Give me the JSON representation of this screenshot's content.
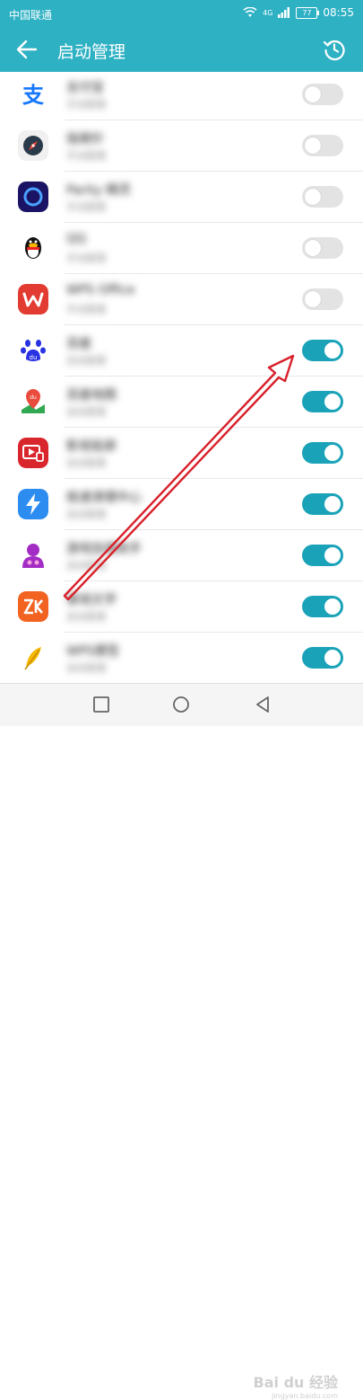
{
  "status_bar": {
    "carrier": "中国联通",
    "signal_text": "4G",
    "battery": "77",
    "time": "08:55"
  },
  "app_bar": {
    "title": "启动管理"
  },
  "apps": [
    {
      "name": "支付宝",
      "sub": "手动管理",
      "icon": "alipay-icon",
      "enabled": false
    },
    {
      "name": "指南针",
      "sub": "手动管理",
      "icon": "compass-icon",
      "enabled": false
    },
    {
      "name": "Parity 精灵",
      "sub": "手动管理",
      "icon": "ring-app-icon",
      "enabled": false
    },
    {
      "name": "QQ",
      "sub": "手动管理",
      "icon": "qq-penguin-icon",
      "enabled": false
    },
    {
      "name": "WPS Office",
      "sub": "手动管理",
      "icon": "wps-icon",
      "enabled": false
    },
    {
      "name": "百度",
      "sub": "自动管理",
      "icon": "baidu-paw-icon",
      "enabled": true
    },
    {
      "name": "百度地图",
      "sub": "自动管理",
      "icon": "baidu-map-icon",
      "enabled": true
    },
    {
      "name": "影视投屏",
      "sub": "自动管理",
      "icon": "video-cast-icon",
      "enabled": true
    },
    {
      "name": "极速清理中心",
      "sub": "自动管理",
      "icon": "lightning-icon",
      "enabled": true
    },
    {
      "name": "游戏加速助手",
      "sub": "自动管理",
      "icon": "avatar-app-icon",
      "enabled": true
    },
    {
      "name": "掌阅文学",
      "sub": "自动管理",
      "icon": "zk-app-icon",
      "enabled": true
    },
    {
      "name": "WPS便签",
      "sub": "自动管理",
      "icon": "feather-icon",
      "enabled": true
    }
  ],
  "watermark": {
    "text": "Bai du 经验",
    "sub": "jingyan.baidu.com"
  },
  "colors": {
    "accent": "#2fb1c4",
    "toggle_on": "#1aa3b8",
    "toggle_off": "#e3e3e3",
    "arrow": "#d8202a"
  }
}
